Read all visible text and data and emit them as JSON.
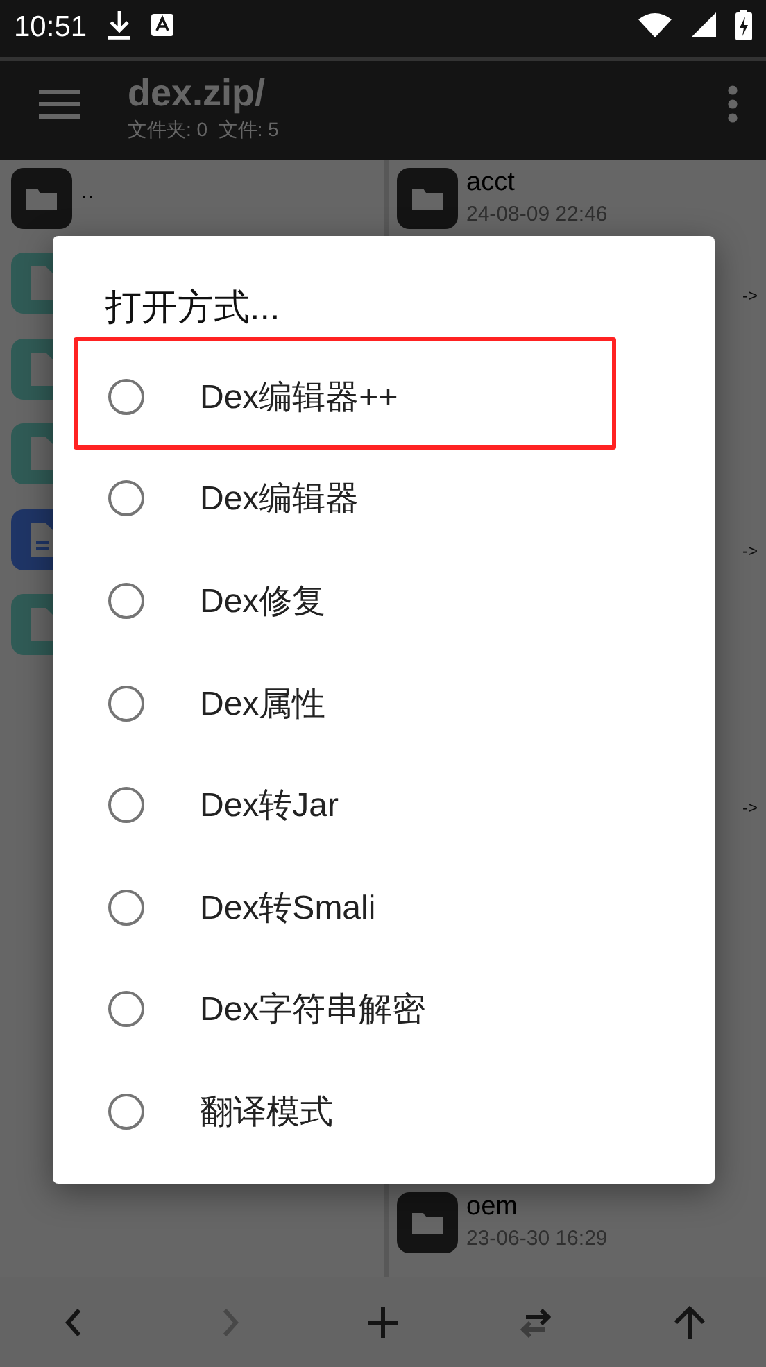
{
  "status_bar": {
    "time": "10:51"
  },
  "app_bar": {
    "title": "dex.zip/",
    "subtitle": "文件夹: 0  文件: 5"
  },
  "left_pane": {
    "items": [
      {
        "kind": "folder",
        "name": ".."
      },
      {
        "kind": "binary"
      },
      {
        "kind": "binary"
      },
      {
        "kind": "binary"
      },
      {
        "kind": "text"
      },
      {
        "kind": "binary"
      }
    ]
  },
  "right_pane": {
    "rows": [
      {
        "kind": "folder",
        "name": "acct",
        "date": "24-08-09 22:46"
      },
      {
        "kind": "covered",
        "link_mark": "->"
      },
      {
        "kind": "covered"
      },
      {
        "kind": "covered"
      },
      {
        "kind": "covered",
        "link_mark": "->"
      },
      {
        "kind": "covered"
      },
      {
        "kind": "covered"
      },
      {
        "kind": "covered",
        "link_mark": "->"
      },
      {
        "kind": "covered"
      },
      {
        "kind": "covered"
      },
      {
        "kind": "covered"
      },
      {
        "kind": "covered"
      },
      {
        "kind": "folder",
        "name": "oem",
        "date": "23-06-30 16:29"
      }
    ]
  },
  "dialog": {
    "title": "打开方式...",
    "options": [
      {
        "label": "Dex编辑器++",
        "selected": false,
        "highlighted": true
      },
      {
        "label": "Dex编辑器",
        "selected": false,
        "highlighted": false
      },
      {
        "label": "Dex修复",
        "selected": false,
        "highlighted": false
      },
      {
        "label": "Dex属性",
        "selected": false,
        "highlighted": false
      },
      {
        "label": "Dex转Jar",
        "selected": false,
        "highlighted": false
      },
      {
        "label": "Dex转Smali",
        "selected": false,
        "highlighted": false
      },
      {
        "label": "Dex字符串解密",
        "selected": false,
        "highlighted": false
      },
      {
        "label": "翻译模式",
        "selected": false,
        "highlighted": false
      }
    ]
  },
  "bottom_bar": {
    "buttons": [
      {
        "kind": "back",
        "disabled": false
      },
      {
        "kind": "forward",
        "disabled": true
      },
      {
        "kind": "add",
        "disabled": false
      },
      {
        "kind": "swap",
        "disabled": false
      },
      {
        "kind": "up",
        "disabled": false
      }
    ]
  }
}
